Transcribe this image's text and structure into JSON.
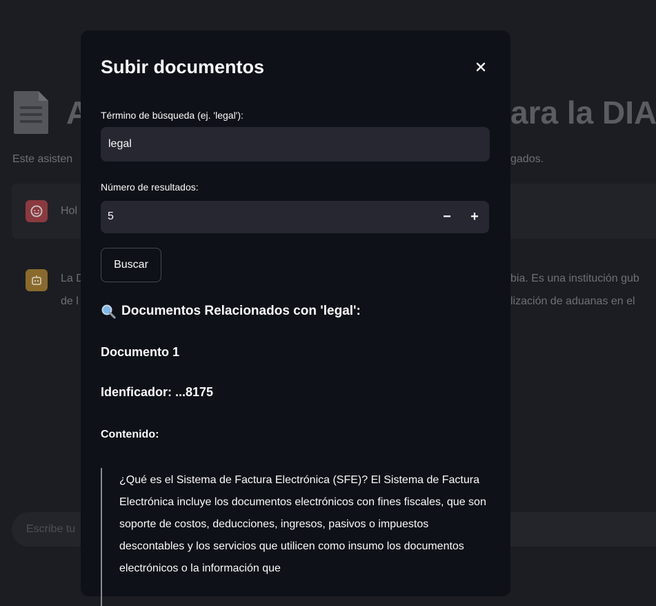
{
  "background": {
    "title_left": "A",
    "title_right": "ara la DIA",
    "description_left": "Este asisten",
    "description_right": "gados.",
    "user_message_text": "Hol",
    "bot_message_line1_left": "La D",
    "bot_message_line2_left": "de l",
    "bot_message_line1_right": "bia. Es una institución gub",
    "bot_message_line2_right": "lización de aduanas en el",
    "chat_input_placeholder": "Escribe tu"
  },
  "modal": {
    "title": "Subir documentos",
    "close_symbol": "✕",
    "search_label": "Término de búsqueda (ej. 'legal'):",
    "search_value": "legal",
    "results_count_label": "Número de resultados:",
    "results_count_value": "5",
    "minus_symbol": "−",
    "plus_symbol": "+",
    "search_button": "Buscar",
    "results_heading": "Documentos Relacionados con 'legal':",
    "document_title": "Documento 1",
    "document_id": "Idenficador: ...8175",
    "content_label": "Contenido:",
    "content_text": "¿Qué es el Sistema de Factura Electrónica (SFE)? El Sistema de Factura Electrónica incluye los documentos electrónicos con fines fiscales, que son soporte de costos, deducciones, ingresos, pasivos o impuestos descontables y los servicios que utilicen como insumo los documentos electrónicos o la información que"
  },
  "colors": {
    "modal_bg": "#0e1117",
    "input_bg": "#262730",
    "page_bg": "#1c1d22"
  }
}
